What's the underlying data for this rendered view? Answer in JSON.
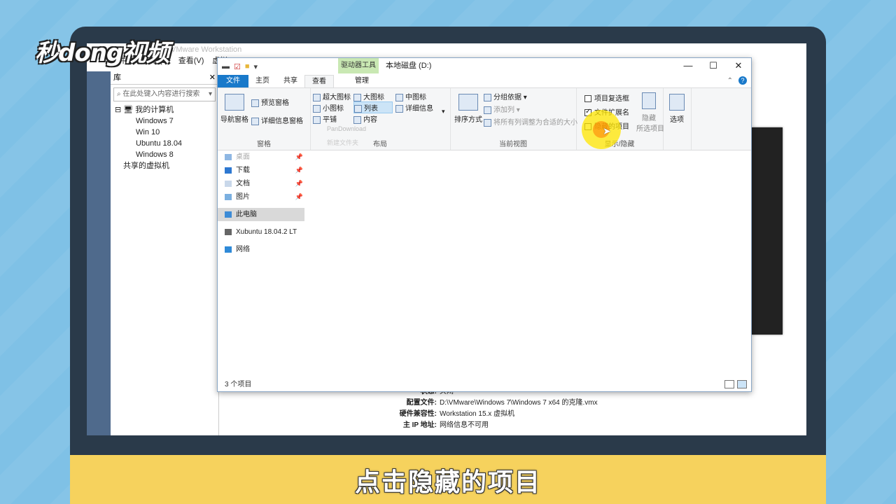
{
  "caption": "点击隐藏的项目",
  "logo": "秒dong视频",
  "vmware": {
    "title": "VMware Workstation",
    "menu": [
      "文件(F)",
      "编辑(E)",
      "查看(V)",
      "虚拟"
    ],
    "library_title": "库",
    "search_placeholder": "在此处键入内容进行搜索",
    "tree": [
      "我的计算机",
      "Windows 7",
      "Win 10",
      "Ubuntu 18.04",
      "Windows 8",
      "共享的虚拟机"
    ],
    "info": [
      {
        "label": "状态:",
        "value": "关闭"
      },
      {
        "label": "配置文件:",
        "value": "D:\\VMware\\Windows  7\\Windows 7 x64 的克隆.vmx"
      },
      {
        "label": "硬件兼容性:",
        "value": "Workstation 15.x 虚拟机"
      },
      {
        "label": "主 IP 地址:",
        "value": "网络信息不可用"
      }
    ]
  },
  "explorer": {
    "contextual_tab": "驱动器工具",
    "title": "本地磁盘 (D:)",
    "tabs": {
      "file": "文件",
      "home": "主页",
      "share": "共享",
      "view": "查看",
      "manage": "管理"
    },
    "panes": {
      "nav": "导航窗格",
      "preview": "预览窗格",
      "details": "详细信息窗格",
      "label": "窗格"
    },
    "layout": {
      "xl": "超大图标",
      "large": "大图标",
      "medium": "中图标",
      "small": "小图标",
      "list": "列表",
      "details": "详细信息",
      "tiles": "平铺",
      "content": "内容",
      "label": "布局"
    },
    "current_view": {
      "sort": "排序方式",
      "group": "分组依据",
      "add_col": "添加列",
      "fit": "将所有列调整为合适的大小",
      "label": "当前视图"
    },
    "show_hide": {
      "checkboxes": "项目复选框",
      "extensions": "文件扩展名",
      "hidden": "隐藏的项目",
      "hide": "隐藏",
      "selected": "所选项目",
      "label": "显示/隐藏"
    },
    "options": "选项",
    "checked": {
      "checkboxes": false,
      "extensions": true,
      "hidden": false
    },
    "nav_items": [
      "桌面",
      "下载",
      "文档",
      "图片",
      "此电脑",
      "Xubuntu 18.04.2 LT",
      "网络"
    ],
    "ghost_items": [
      "PanDownload",
      "新建文件夹"
    ],
    "status": "3 个项目"
  }
}
